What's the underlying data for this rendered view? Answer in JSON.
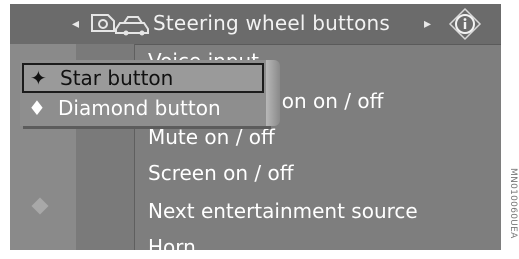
{
  "header": {
    "title": "Steering wheel buttons",
    "left_arrow": "◂",
    "right_arrow": "▸",
    "icon": "steering-vehicle-icon",
    "info_icon": "info-icon"
  },
  "popup": {
    "items": [
      {
        "glyph": "✦",
        "label": "Star button",
        "selected": true
      },
      {
        "glyph": "♦",
        "label": "Diamond button",
        "selected": false
      }
    ]
  },
  "list": {
    "items": [
      {
        "label": "Voice input"
      },
      {
        "label": "Voice activation on / off"
      },
      {
        "label": "Mute on / off"
      },
      {
        "label": "Screen on / off"
      },
      {
        "label": "Next entertainment source"
      },
      {
        "label": "Horn"
      }
    ]
  },
  "reference_code": "MN010060UEA",
  "colors": {
    "screen_bg": "#7e7e7e",
    "header_bg": "#6b6b6b",
    "text": "#ffffff",
    "selection_border": "#1c1c1c"
  }
}
